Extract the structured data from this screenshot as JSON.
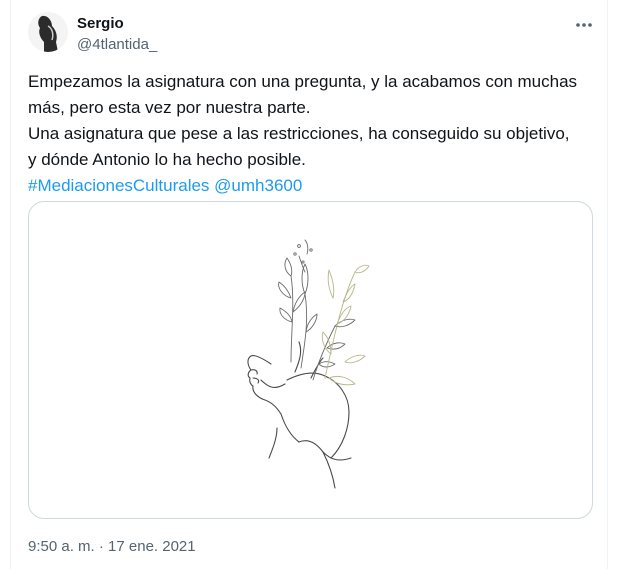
{
  "author": {
    "name": "Sergio",
    "handle": "@4tlantida_"
  },
  "tweet": {
    "line1": "Empezamos la asignatura con una pregunta, y la acabamos con muchas",
    "line2": "más, pero esta vez por nuestra parte.",
    "line3": "Una asignatura que pese a las restricciones, ha conseguido su objetivo,",
    "line4": "y dónde Antonio lo ha hecho posible.",
    "hashtag": "#MediacionesCulturales",
    "mention": "@umh3600"
  },
  "timestamp": "9:50 a. m. · 17 ene. 2021",
  "icons": {
    "more": "more-horizontal-icon"
  },
  "colors": {
    "link": "#1d9bf0",
    "secondary_text": "#536471",
    "primary_text": "#0f1419",
    "border": "#cfd9de"
  }
}
